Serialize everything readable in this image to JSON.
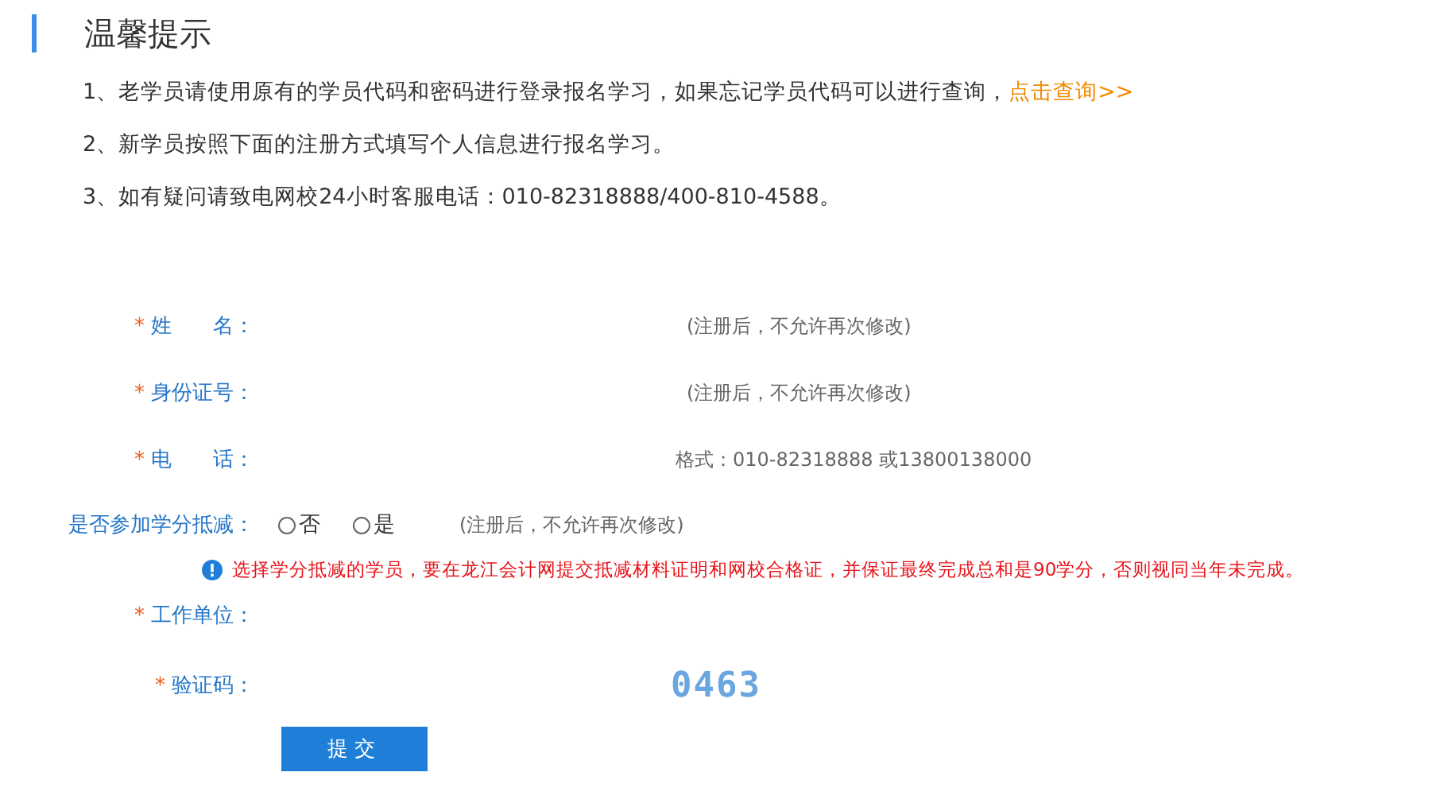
{
  "notice": {
    "title": "温馨提示",
    "items": [
      {
        "text": "1、老学员请使用原有的学员代码和密码进行登录报名学习，如果忘记学员代码可以进行查询，",
        "link": "点击查询>>"
      },
      {
        "text": "2、新学员按照下面的注册方式填写个人信息进行报名学习。"
      },
      {
        "text": "3、如有疑问请致电网校24小时客服电话：010-82318888/400-810-4588。"
      }
    ]
  },
  "form": {
    "rows": [
      {
        "kind": "field",
        "required": "*",
        "label": "姓　　名：",
        "hint": "(注册后，不允许再次修改)"
      },
      {
        "kind": "field",
        "required": "*",
        "label": "身份证号：",
        "hint": "(注册后，不允许再次修改)"
      },
      {
        "kind": "field",
        "required": "*",
        "label": "电　　话：",
        "hint": "格式：010-82318888 或13800138000"
      },
      {
        "kind": "radio",
        "label": "是否参加学分抵减：",
        "options": [
          {
            "label": "否",
            "selected": false
          },
          {
            "label": "是",
            "selected": false
          }
        ],
        "hint": "(注册后，不允许再次修改)"
      },
      {
        "kind": "warning",
        "text": "选择学分抵减的学员，要在龙江会计网提交抵减材料证明和网校合格证，并保证最终完成总和是90学分，否则视同当年未完成。"
      },
      {
        "kind": "field",
        "required": "*",
        "label": "工作单位："
      },
      {
        "kind": "captcha",
        "required": "*",
        "label": "验证码：",
        "code": "0463"
      }
    ],
    "submit": "提交"
  }
}
